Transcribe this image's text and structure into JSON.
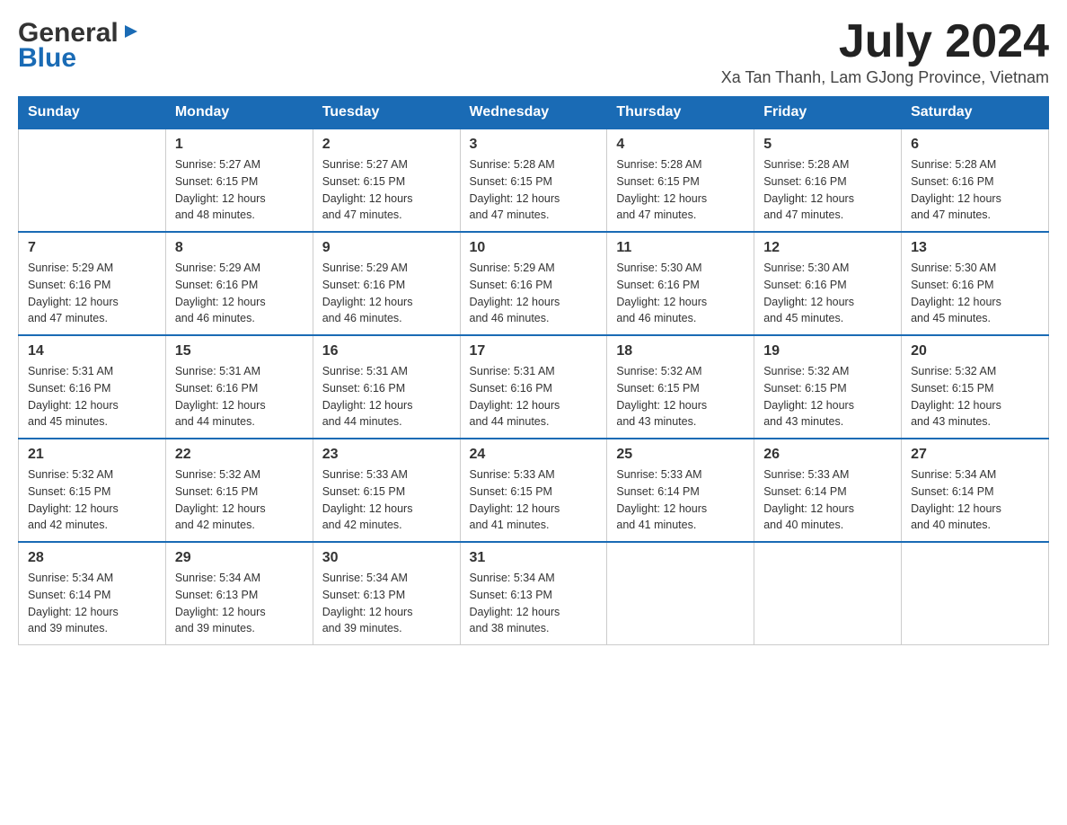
{
  "logo": {
    "general": "General",
    "triangle": "▶",
    "blue": "Blue"
  },
  "header": {
    "month_year": "July 2024",
    "location": "Xa Tan Thanh, Lam GJong Province, Vietnam"
  },
  "days_of_week": [
    "Sunday",
    "Monday",
    "Tuesday",
    "Wednesday",
    "Thursday",
    "Friday",
    "Saturday"
  ],
  "weeks": [
    {
      "days": [
        {
          "number": "",
          "info": ""
        },
        {
          "number": "1",
          "info": "Sunrise: 5:27 AM\nSunset: 6:15 PM\nDaylight: 12 hours\nand 48 minutes."
        },
        {
          "number": "2",
          "info": "Sunrise: 5:27 AM\nSunset: 6:15 PM\nDaylight: 12 hours\nand 47 minutes."
        },
        {
          "number": "3",
          "info": "Sunrise: 5:28 AM\nSunset: 6:15 PM\nDaylight: 12 hours\nand 47 minutes."
        },
        {
          "number": "4",
          "info": "Sunrise: 5:28 AM\nSunset: 6:15 PM\nDaylight: 12 hours\nand 47 minutes."
        },
        {
          "number": "5",
          "info": "Sunrise: 5:28 AM\nSunset: 6:16 PM\nDaylight: 12 hours\nand 47 minutes."
        },
        {
          "number": "6",
          "info": "Sunrise: 5:28 AM\nSunset: 6:16 PM\nDaylight: 12 hours\nand 47 minutes."
        }
      ]
    },
    {
      "days": [
        {
          "number": "7",
          "info": "Sunrise: 5:29 AM\nSunset: 6:16 PM\nDaylight: 12 hours\nand 47 minutes."
        },
        {
          "number": "8",
          "info": "Sunrise: 5:29 AM\nSunset: 6:16 PM\nDaylight: 12 hours\nand 46 minutes."
        },
        {
          "number": "9",
          "info": "Sunrise: 5:29 AM\nSunset: 6:16 PM\nDaylight: 12 hours\nand 46 minutes."
        },
        {
          "number": "10",
          "info": "Sunrise: 5:29 AM\nSunset: 6:16 PM\nDaylight: 12 hours\nand 46 minutes."
        },
        {
          "number": "11",
          "info": "Sunrise: 5:30 AM\nSunset: 6:16 PM\nDaylight: 12 hours\nand 46 minutes."
        },
        {
          "number": "12",
          "info": "Sunrise: 5:30 AM\nSunset: 6:16 PM\nDaylight: 12 hours\nand 45 minutes."
        },
        {
          "number": "13",
          "info": "Sunrise: 5:30 AM\nSunset: 6:16 PM\nDaylight: 12 hours\nand 45 minutes."
        }
      ]
    },
    {
      "days": [
        {
          "number": "14",
          "info": "Sunrise: 5:31 AM\nSunset: 6:16 PM\nDaylight: 12 hours\nand 45 minutes."
        },
        {
          "number": "15",
          "info": "Sunrise: 5:31 AM\nSunset: 6:16 PM\nDaylight: 12 hours\nand 44 minutes."
        },
        {
          "number": "16",
          "info": "Sunrise: 5:31 AM\nSunset: 6:16 PM\nDaylight: 12 hours\nand 44 minutes."
        },
        {
          "number": "17",
          "info": "Sunrise: 5:31 AM\nSunset: 6:16 PM\nDaylight: 12 hours\nand 44 minutes."
        },
        {
          "number": "18",
          "info": "Sunrise: 5:32 AM\nSunset: 6:15 PM\nDaylight: 12 hours\nand 43 minutes."
        },
        {
          "number": "19",
          "info": "Sunrise: 5:32 AM\nSunset: 6:15 PM\nDaylight: 12 hours\nand 43 minutes."
        },
        {
          "number": "20",
          "info": "Sunrise: 5:32 AM\nSunset: 6:15 PM\nDaylight: 12 hours\nand 43 minutes."
        }
      ]
    },
    {
      "days": [
        {
          "number": "21",
          "info": "Sunrise: 5:32 AM\nSunset: 6:15 PM\nDaylight: 12 hours\nand 42 minutes."
        },
        {
          "number": "22",
          "info": "Sunrise: 5:32 AM\nSunset: 6:15 PM\nDaylight: 12 hours\nand 42 minutes."
        },
        {
          "number": "23",
          "info": "Sunrise: 5:33 AM\nSunset: 6:15 PM\nDaylight: 12 hours\nand 42 minutes."
        },
        {
          "number": "24",
          "info": "Sunrise: 5:33 AM\nSunset: 6:15 PM\nDaylight: 12 hours\nand 41 minutes."
        },
        {
          "number": "25",
          "info": "Sunrise: 5:33 AM\nSunset: 6:14 PM\nDaylight: 12 hours\nand 41 minutes."
        },
        {
          "number": "26",
          "info": "Sunrise: 5:33 AM\nSunset: 6:14 PM\nDaylight: 12 hours\nand 40 minutes."
        },
        {
          "number": "27",
          "info": "Sunrise: 5:34 AM\nSunset: 6:14 PM\nDaylight: 12 hours\nand 40 minutes."
        }
      ]
    },
    {
      "days": [
        {
          "number": "28",
          "info": "Sunrise: 5:34 AM\nSunset: 6:14 PM\nDaylight: 12 hours\nand 39 minutes."
        },
        {
          "number": "29",
          "info": "Sunrise: 5:34 AM\nSunset: 6:13 PM\nDaylight: 12 hours\nand 39 minutes."
        },
        {
          "number": "30",
          "info": "Sunrise: 5:34 AM\nSunset: 6:13 PM\nDaylight: 12 hours\nand 39 minutes."
        },
        {
          "number": "31",
          "info": "Sunrise: 5:34 AM\nSunset: 6:13 PM\nDaylight: 12 hours\nand 38 minutes."
        },
        {
          "number": "",
          "info": ""
        },
        {
          "number": "",
          "info": ""
        },
        {
          "number": "",
          "info": ""
        }
      ]
    }
  ]
}
